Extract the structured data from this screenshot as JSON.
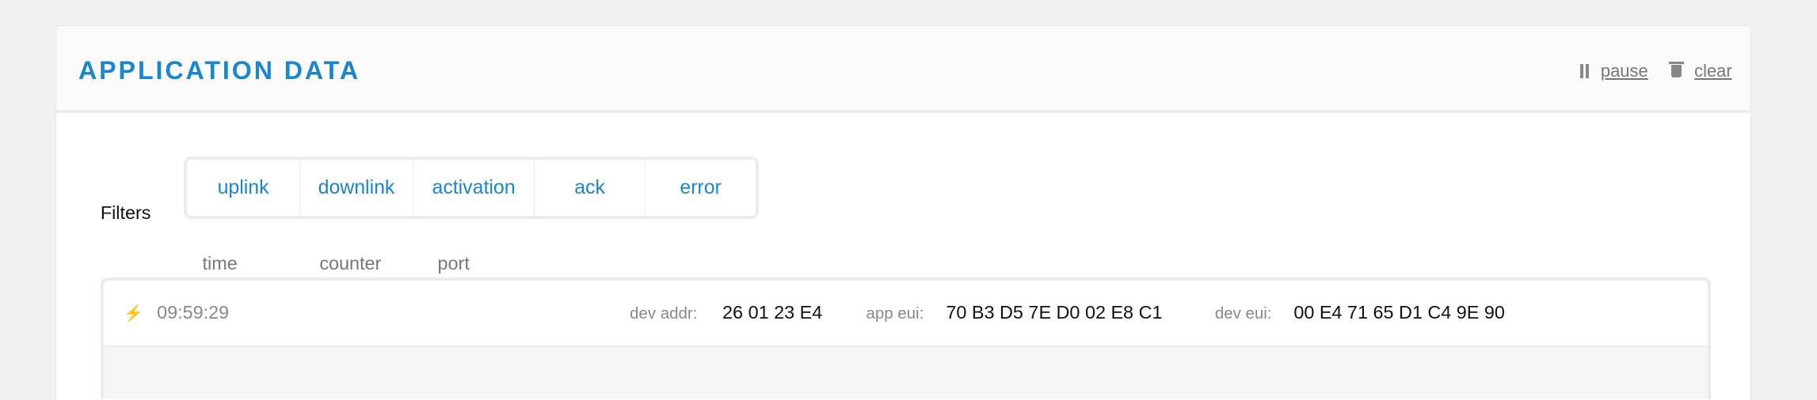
{
  "header": {
    "title": "APPLICATION DATA",
    "pause_label": "pause",
    "clear_label": "clear"
  },
  "filters": {
    "label": "Filters",
    "items": [
      "uplink",
      "downlink",
      "activation",
      "ack",
      "error"
    ]
  },
  "columns": {
    "time": "time",
    "counter": "counter",
    "port": "port"
  },
  "rows": [
    {
      "icon": "bolt-icon",
      "time": "09:59:29",
      "dev_addr_label": "dev addr:",
      "dev_addr": "26 01 23 E4",
      "app_eui_label": "app eui:",
      "app_eui": "70 B3 D5 7E D0 02 E8 C1",
      "dev_eui_label": "dev eui:",
      "dev_eui": "00 E4 71 65 D1 C4 9E 90"
    }
  ],
  "colors": {
    "accent": "#1b85d0",
    "activation_icon": "#f7c33d"
  }
}
